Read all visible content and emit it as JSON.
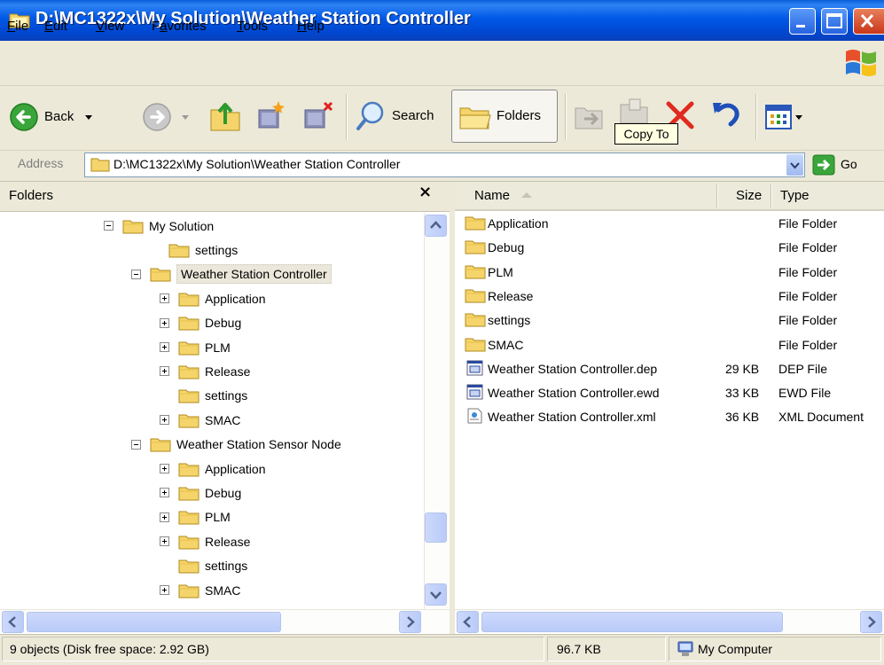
{
  "window": {
    "title": "D:\\MC1322x\\My Solution\\Weather Station Controller"
  },
  "menu": [
    {
      "pre": "",
      "ul": "F",
      "post": "ile"
    },
    {
      "pre": "",
      "ul": "E",
      "post": "dit"
    },
    {
      "pre": "",
      "ul": "V",
      "post": "iew"
    },
    {
      "pre": "F",
      "ul": "a",
      "post": "vorites"
    },
    {
      "pre": "",
      "ul": "T",
      "post": "ools"
    },
    {
      "pre": "",
      "ul": "H",
      "post": "elp"
    }
  ],
  "toolbar": {
    "back_label": "Back",
    "search_label": "Search",
    "folders_label": "Folders",
    "tooltip": "Copy To"
  },
  "address": {
    "label": "Address",
    "value": "D:\\MC1322x\\My Solution\\Weather Station Controller",
    "go_label": "Go"
  },
  "folders_pane": {
    "title": "Folders",
    "close": "×"
  },
  "tree": [
    {
      "label": "My Solution",
      "depth": 0,
      "expander": "minus"
    },
    {
      "label": "settings",
      "depth": 1,
      "expander": "none"
    },
    {
      "label": "Weather Station Controller",
      "depth": 1,
      "expander": "minus",
      "selected": true
    },
    {
      "label": "Application",
      "depth": 2,
      "expander": "plus"
    },
    {
      "label": "Debug",
      "depth": 2,
      "expander": "plus"
    },
    {
      "label": "PLM",
      "depth": 2,
      "expander": "plus"
    },
    {
      "label": "Release",
      "depth": 2,
      "expander": "plus"
    },
    {
      "label": "settings",
      "depth": 2,
      "expander": "none"
    },
    {
      "label": "SMAC",
      "depth": 2,
      "expander": "plus"
    },
    {
      "label": "Weather Station Sensor Node",
      "depth": 1,
      "expander": "minus"
    },
    {
      "label": "Application",
      "depth": 2,
      "expander": "plus"
    },
    {
      "label": "Debug",
      "depth": 2,
      "expander": "plus"
    },
    {
      "label": "PLM",
      "depth": 2,
      "expander": "plus"
    },
    {
      "label": "Release",
      "depth": 2,
      "expander": "plus"
    },
    {
      "label": "settings",
      "depth": 2,
      "expander": "none"
    },
    {
      "label": "SMAC",
      "depth": 2,
      "expander": "plus"
    }
  ],
  "columns": {
    "name": "Name",
    "size": "Size",
    "type": "Type"
  },
  "files": [
    {
      "name": "Application",
      "size": "",
      "type": "File Folder",
      "icon": "folder-icon"
    },
    {
      "name": "Debug",
      "size": "",
      "type": "File Folder",
      "icon": "folder-icon"
    },
    {
      "name": "PLM",
      "size": "",
      "type": "File Folder",
      "icon": "folder-icon"
    },
    {
      "name": "Release",
      "size": "",
      "type": "File Folder",
      "icon": "folder-icon"
    },
    {
      "name": "settings",
      "size": "",
      "type": "File Folder",
      "icon": "folder-icon"
    },
    {
      "name": "SMAC",
      "size": "",
      "type": "File Folder",
      "icon": "folder-icon"
    },
    {
      "name": "Weather Station Controller.dep",
      "size": "29 KB",
      "type": "DEP File",
      "icon": "workspace-file-icon"
    },
    {
      "name": "Weather Station Controller.ewd",
      "size": "33 KB",
      "type": "EWD File",
      "icon": "workspace-file-icon"
    },
    {
      "name": "Weather Station Controller.xml",
      "size": "36 KB",
      "type": "XML Document",
      "icon": "xml-file-icon"
    }
  ],
  "status": {
    "objects": "9 objects (Disk free space: 2.92 GB)",
    "size": "96.7 KB",
    "location": "My Computer"
  }
}
